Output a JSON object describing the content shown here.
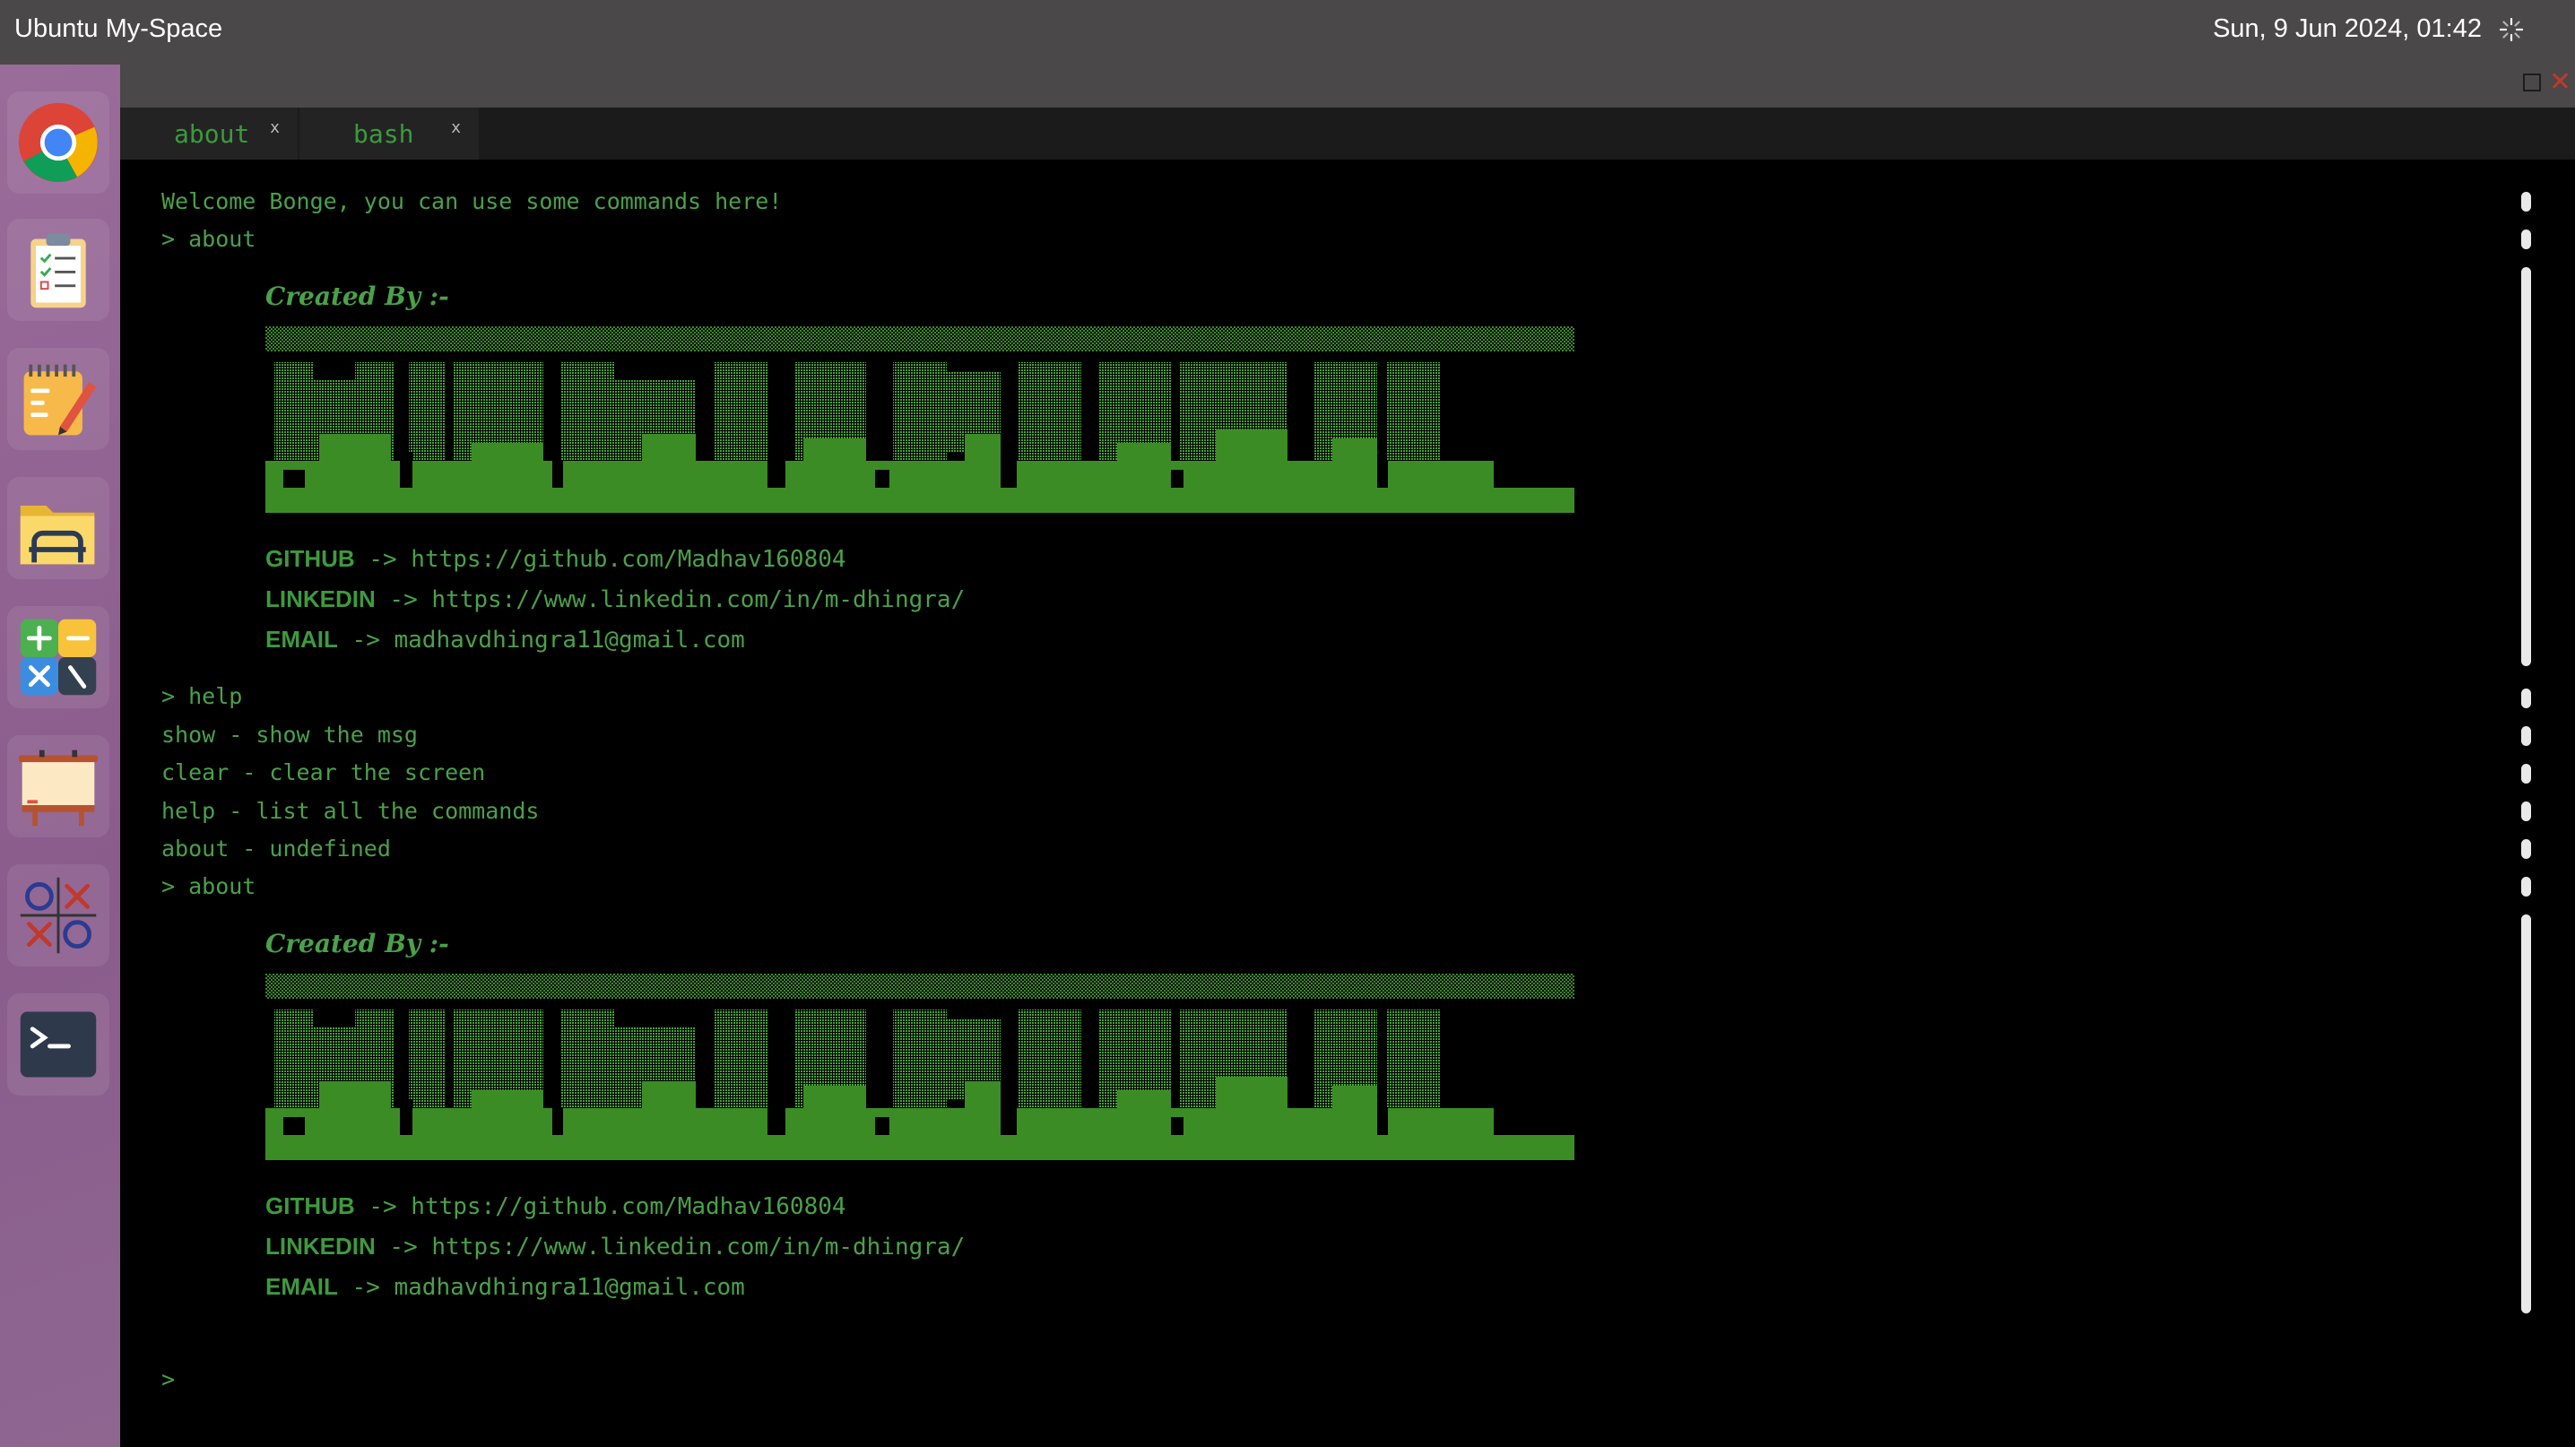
{
  "topbar": {
    "title": "Ubuntu My-Space",
    "datetime": "Sun, 9 Jun 2024, 01:42"
  },
  "dock": [
    {
      "name": "chrome-icon"
    },
    {
      "name": "todo-icon"
    },
    {
      "name": "notes-icon"
    },
    {
      "name": "files-icon"
    },
    {
      "name": "calculator-icon"
    },
    {
      "name": "whiteboard-icon"
    },
    {
      "name": "tic-tac-toe-icon"
    },
    {
      "name": "terminal-icon"
    }
  ],
  "tabs": [
    {
      "label": "about",
      "close": "x"
    },
    {
      "label": "bash",
      "close": "x"
    }
  ],
  "terminal": {
    "welcome": "Welcome Bonge, you can use some commands here!",
    "cmd_about": "> about",
    "cmd_help": "> help",
    "help_lines": [
      "show - show the msg",
      "clear - clear the screen",
      "help - list all the commands",
      "about - undefined"
    ],
    "prompt": ">",
    "about_block": {
      "created_by": "Created By :-",
      "github_key": "GITHUB",
      "github_val": " -> https://github.com/Madhav160804",
      "linkedin_key": "LINKEDIN",
      "linkedin_val": " -> https://www.linkedin.com/in/m-dhingra/",
      "email_key": "EMAIL",
      "email_val": " -> madhavdhingra11@gmail.com"
    }
  },
  "colors": {
    "terminal_green": "#4aa14a",
    "topbar_bg": "#4a4848",
    "dock_bg": "#8e6690"
  }
}
